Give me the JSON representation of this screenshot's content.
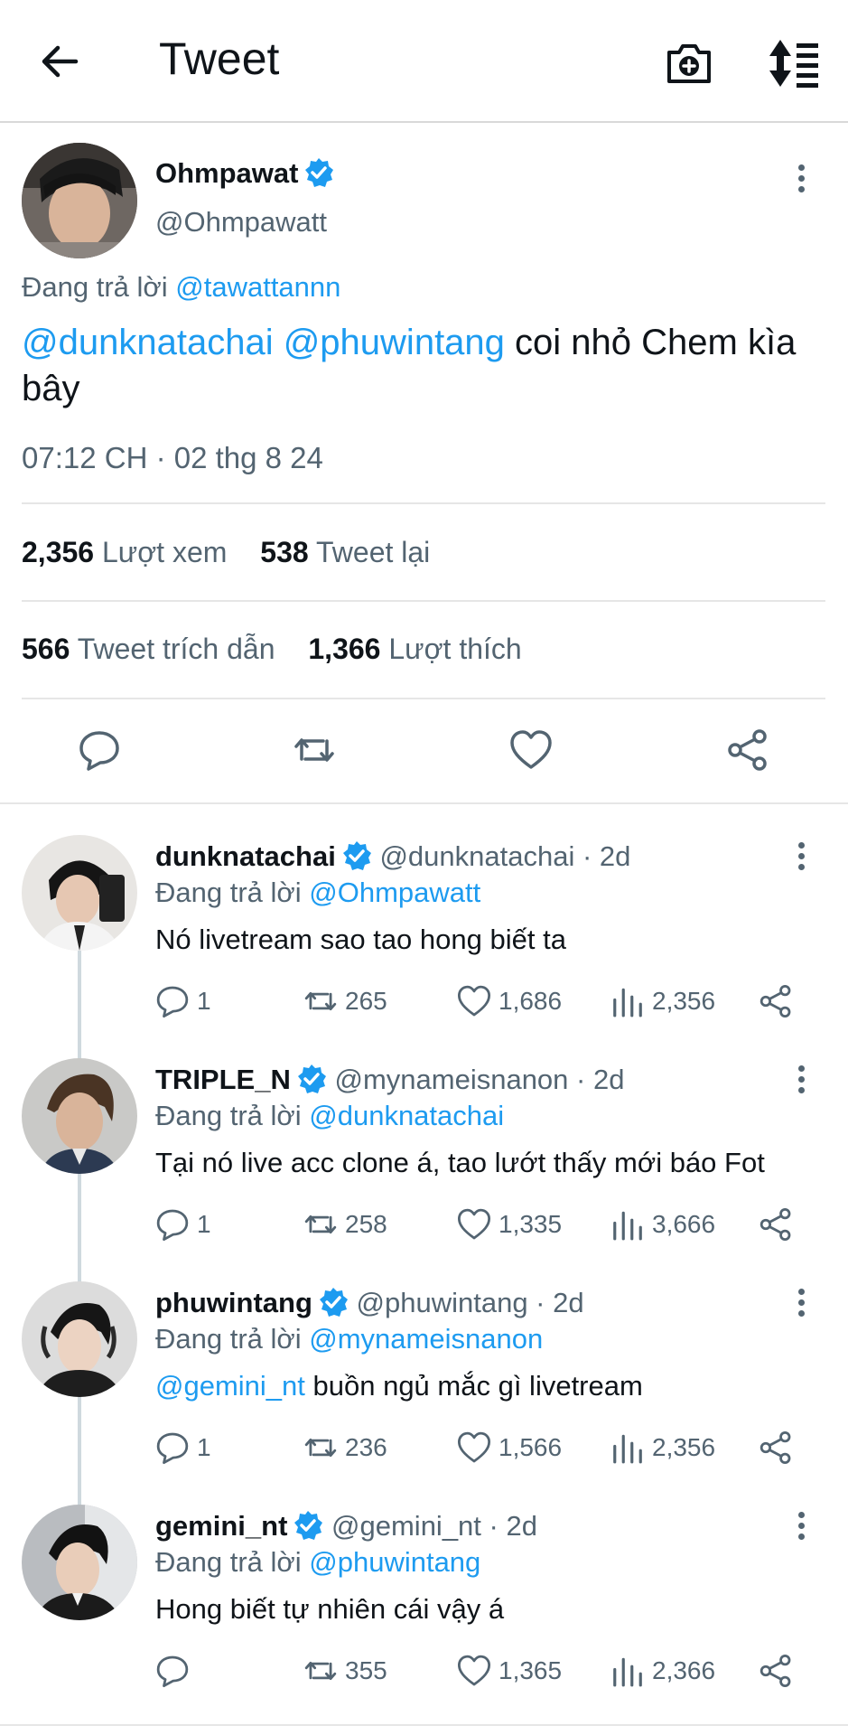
{
  "header": {
    "title": "Tweet"
  },
  "tweet": {
    "author_name": "Ohmpawat",
    "author_handle": "@Ohmpawatt",
    "replying_prefix": "Đang trả lời",
    "replying_to": "@tawattannn",
    "mention_1": "@dunknatachai",
    "mention_2": "@phuwintang",
    "text_rest": "coi nhỏ Chem kìa bây",
    "timestamp": "07:12 CH · 02 thg 8 24",
    "views_count": "2,356",
    "views_label": "Lượt xem",
    "retweets_count": "538",
    "retweets_label": "Tweet lại",
    "quotes_count": "566",
    "quotes_label": "Tweet trích dẫn",
    "likes_count": "1,366",
    "likes_label": "Lượt thích"
  },
  "replies": [
    {
      "name": "dunknatachai",
      "handle": "@dunknatachai · 2d",
      "replying_prefix": "Đang trả lời",
      "replying_to": "@Ohmpawatt",
      "mention": "",
      "text": "Nó livetream sao tao hong biết ta",
      "reply_count": "1",
      "retweet_count": "265",
      "like_count": "1,686",
      "view_count": "2,356"
    },
    {
      "name": "TRIPLE_N",
      "handle": "@mynameisnanon · 2d",
      "replying_prefix": "Đang trả lời",
      "replying_to": "@dunknatachai",
      "mention": "",
      "text": "Tại nó live acc clone á, tao lướt thấy mới báo Fot",
      "reply_count": "1",
      "retweet_count": "258",
      "like_count": "1,335",
      "view_count": "3,666"
    },
    {
      "name": "phuwintang",
      "handle": "@phuwintang · 2d",
      "replying_prefix": "Đang trả lời",
      "replying_to": "@mynameisnanon",
      "mention": "@gemini_nt",
      "text": " buồn ngủ mắc gì livetream",
      "reply_count": "1",
      "retweet_count": "236",
      "like_count": "1,566",
      "view_count": "2,356"
    },
    {
      "name": "gemini_nt",
      "handle": "@gemini_nt · 2d",
      "replying_prefix": "Đang trả lời",
      "replying_to": "@phuwintang",
      "mention": "",
      "text": "Hong biết tự nhiên cái vậy á",
      "reply_count": "",
      "retweet_count": "355",
      "like_count": "1,365",
      "view_count": "2,366"
    }
  ],
  "colors": {
    "accent": "#1d9bf0",
    "secondary_text": "#536471",
    "primary_text": "#0f1419"
  }
}
